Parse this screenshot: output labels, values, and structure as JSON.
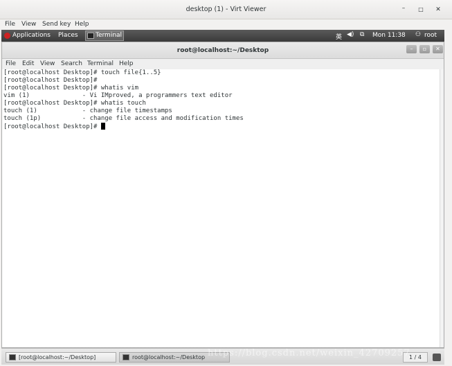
{
  "viewer": {
    "title": "desktop (1) - Virt Viewer",
    "controls": {
      "minimize": "–",
      "maximize": "□",
      "close": "✕"
    },
    "menu": [
      "File",
      "View",
      "Send key",
      "Help"
    ]
  },
  "topbar": {
    "applications": "Applications",
    "places": "Places",
    "terminal_task": "Terminal",
    "input_method": "英",
    "clock": "Mon 11:38",
    "user": "root"
  },
  "terminal": {
    "title": "root@localhost:~/Desktop",
    "controls": {
      "minimize": "–",
      "maximize": "▫",
      "close": "✕"
    },
    "menu": [
      "File",
      "Edit",
      "View",
      "Search",
      "Terminal",
      "Help"
    ],
    "lines": [
      "[root@localhost Desktop]# touch file{1..5}",
      "[root@localhost Desktop]#",
      "[root@localhost Desktop]# whatis vim",
      "vim (1)              - Vi IMproved, a programmers text editor",
      "[root@localhost Desktop]# whatis touch",
      "touch (1)            - change file timestamps",
      "touch (1p)           - change file access and modification times"
    ],
    "prompt": "[root@localhost Desktop]# "
  },
  "taskbar": {
    "tasks": [
      "[root@localhost:~/Desktop]",
      "root@localhost:~/Desktop"
    ],
    "workspace": "1 / 4"
  },
  "watermark": "https://blog.csdn.net/weixin_42709257"
}
